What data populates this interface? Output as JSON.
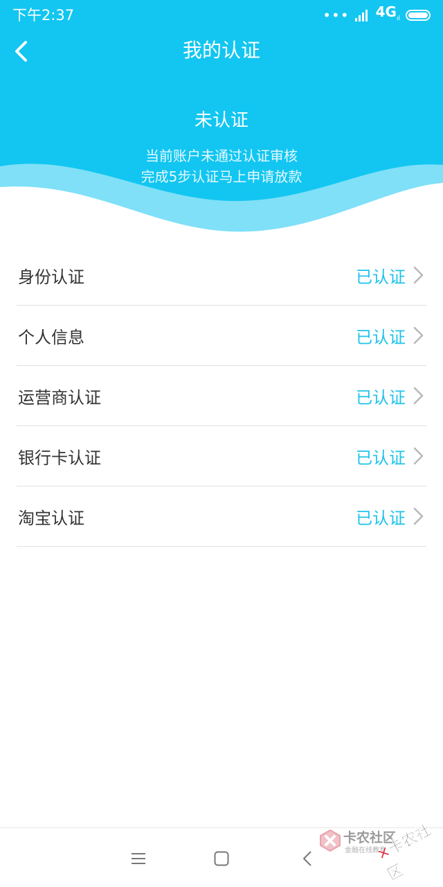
{
  "status_bar": {
    "time": "下午2:37",
    "network": "4G",
    "network_sub": "ıl",
    "signal_dots": "•••"
  },
  "header": {
    "title": "我的认证"
  },
  "summary": {
    "status": "未认证",
    "line1": "当前账户未通过认证审核",
    "line2": "完成5步认证马上申请放款"
  },
  "certifications": [
    {
      "label": "身份认证",
      "status": "已认证"
    },
    {
      "label": "个人信息",
      "status": "已认证"
    },
    {
      "label": "运营商认证",
      "status": "已认证"
    },
    {
      "label": "银行卡认证",
      "status": "已认证"
    },
    {
      "label": "淘宝认证",
      "status": "已认证"
    }
  ],
  "watermark": {
    "brand": "卡农社区",
    "tagline": "金融在线教育",
    "stamp": "卡农社区"
  },
  "colors": {
    "header_blue": "#12c6f1",
    "wave_light": "#7fe0f8",
    "status_text": "#1fc3ea"
  },
  "icons": {
    "back": "chevron-left-icon",
    "row_arrow": "chevron-right-icon",
    "nav_menu": "menu-icon",
    "nav_home": "home-square-icon",
    "nav_back": "back-triangle-icon"
  }
}
